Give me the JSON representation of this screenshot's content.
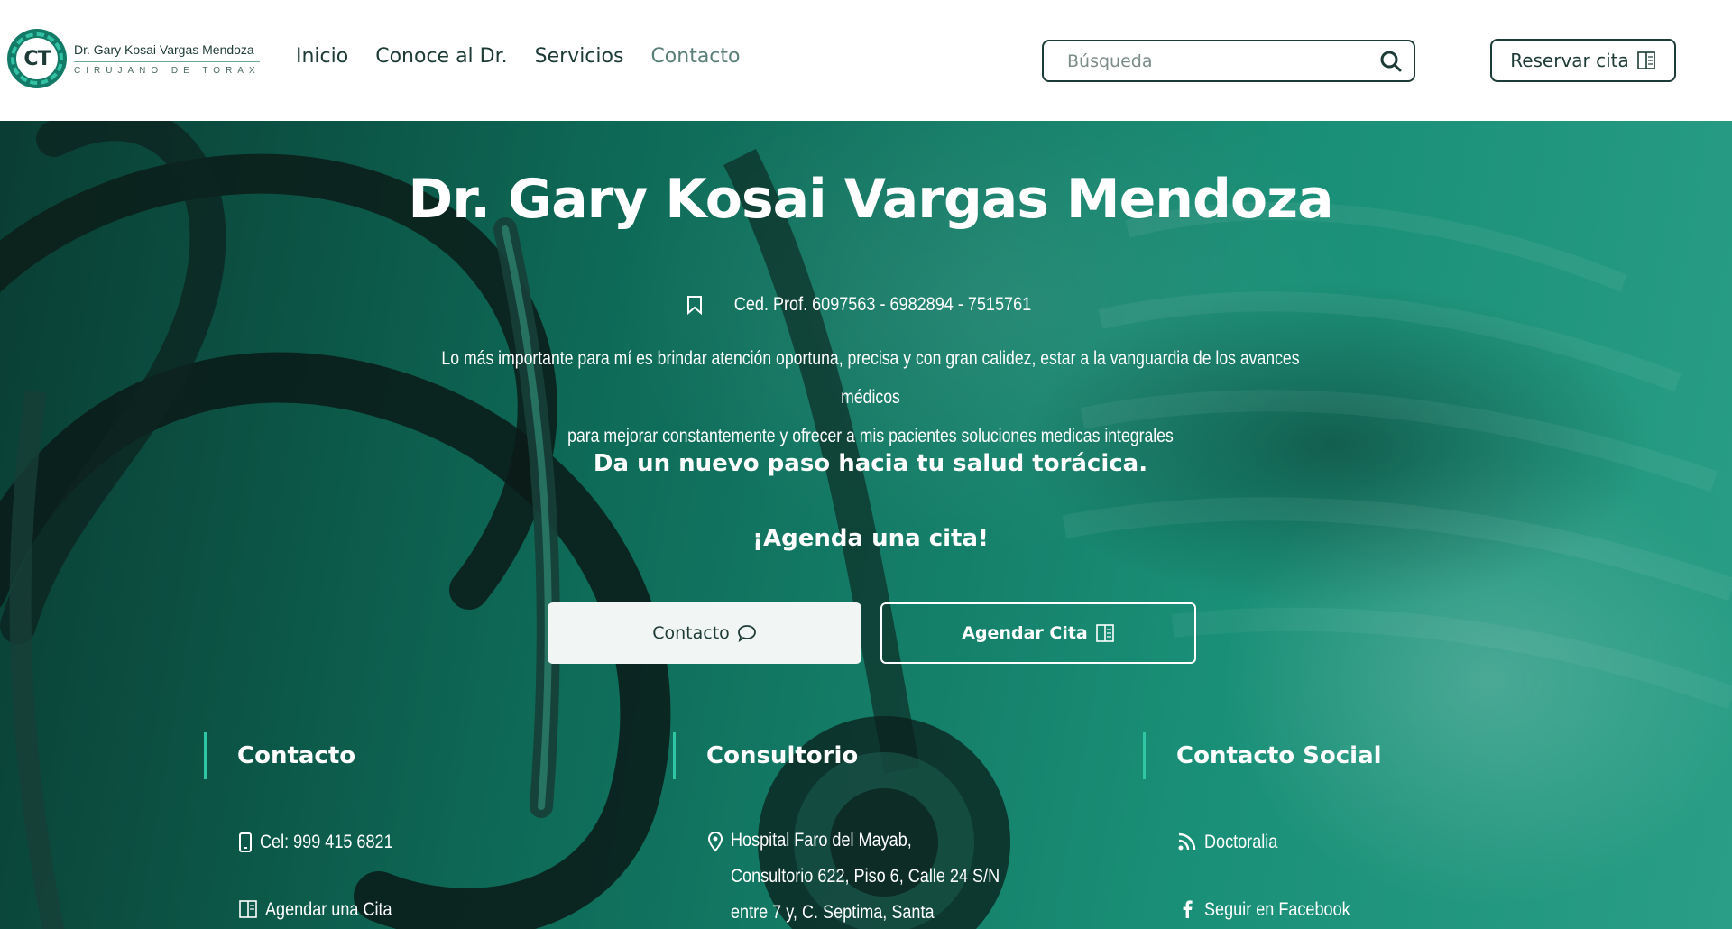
{
  "header": {
    "logo_initials": "CT",
    "logo_name": "Dr. Gary Kosai Vargas Mendoza",
    "logo_subtitle": "CIRUJANO DE TORAX",
    "nav": [
      "Inicio",
      "Conoce al Dr.",
      "Servicios",
      "Contacto"
    ],
    "search_placeholder": "Búsqueda",
    "reserve_label": "Reservar cita"
  },
  "hero": {
    "title": "Dr. Gary Kosai Vargas Mendoza",
    "ced": "Ced. Prof. 6097563 - 6982894 - 7515761",
    "description_line1": "Lo más importante para mí es brindar atención oportuna, precisa y con gran calidez, estar a la vanguardia de los avances médicos",
    "description_line2": "para mejorar constantemente y ofrecer a mis pacientes soluciones medicas integrales",
    "step": "Da un nuevo paso hacia tu salud torácica.",
    "cta": "¡Agenda una cita!",
    "btn_contact": "Contacto",
    "btn_schedule": "Agendar Cita"
  },
  "footer_cols": {
    "contacto": {
      "title": "Contacto",
      "phone": "Cel: 999 415 6821",
      "schedule": "Agendar una Cita"
    },
    "consultorio": {
      "title": "Consultorio",
      "address_line1": "Hospital Faro del Mayab,",
      "address_line2": "Consultorio 622, Piso 6, Calle 24 S/N",
      "address_line3": "entre 7 y, C. Septima, Santa"
    },
    "social": {
      "title": "Contacto Social",
      "doctoralia": "Doctoralia",
      "facebook": "Seguir en Facebook"
    }
  },
  "colors": {
    "brand_dark": "#1d3b36",
    "accent": "#2fc6a5",
    "hero_base": "#0e6b58"
  }
}
